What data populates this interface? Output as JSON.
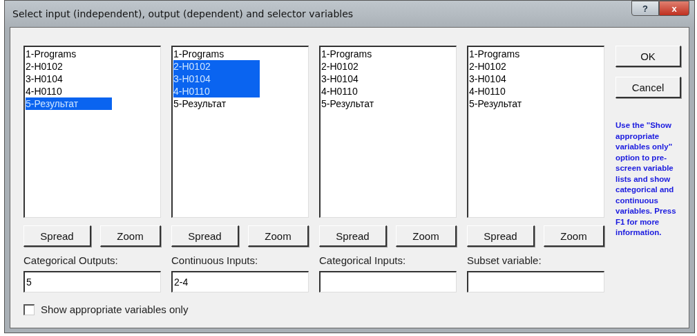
{
  "window": {
    "title": "Select input (independent), output (dependent) and selector variables",
    "help_button": "?",
    "close_button": "x"
  },
  "lists": [
    {
      "items": [
        {
          "label": "1-Programs",
          "selected": false
        },
        {
          "label": "2-H0102",
          "selected": false
        },
        {
          "label": "3-H0104",
          "selected": false
        },
        {
          "label": "4-H0110",
          "selected": false
        },
        {
          "label": "5-Результат",
          "selected": true
        }
      ],
      "buttons": [
        "Spread",
        "Zoom"
      ],
      "field_label": "Categorical Outputs:",
      "value": "5"
    },
    {
      "items": [
        {
          "label": "1-Programs",
          "selected": false
        },
        {
          "label": "2-H0102",
          "selected": true
        },
        {
          "label": "3-H0104",
          "selected": true
        },
        {
          "label": "4-H0110",
          "selected": true
        },
        {
          "label": "5-Результат",
          "selected": false
        }
      ],
      "buttons": [
        "Spread",
        "Zoom"
      ],
      "field_label": "Continuous Inputs:",
      "value": "2-4"
    },
    {
      "items": [
        {
          "label": "1-Programs",
          "selected": false
        },
        {
          "label": "2-H0102",
          "selected": false
        },
        {
          "label": "3-H0104",
          "selected": false
        },
        {
          "label": "4-H0110",
          "selected": false
        },
        {
          "label": "5-Результат",
          "selected": false
        }
      ],
      "buttons": [
        "Spread",
        "Zoom"
      ],
      "field_label": "Categorical Inputs:"
    },
    {
      "items": [
        {
          "label": "1-Programs",
          "selected": false
        },
        {
          "label": "2-H0102",
          "selected": false
        },
        {
          "label": "3-H0104",
          "selected": false
        },
        {
          "label": "4-H0110",
          "selected": false
        },
        {
          "label": "5-Результат",
          "selected": false
        }
      ],
      "buttons": [
        "Spread",
        "Zoom"
      ],
      "field_label": "Subset variable:"
    }
  ],
  "buttons": [
    "OK",
    "Cancel"
  ],
  "help_text": "Use the \"Show appropriate variables only\" option to pre-screen variable lists and show categorical and continuous variables. Press F1 for more information.",
  "checkbox": {
    "label": "Show appropriate variables only",
    "checked": false
  }
}
